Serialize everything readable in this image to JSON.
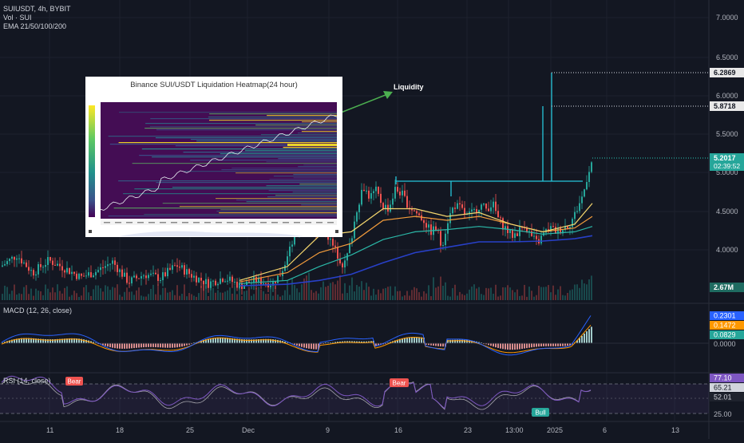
{
  "header": {
    "symbol_line": "SUIUSDT, 4h, BYBIT",
    "vol_line": "Vol · SUI",
    "ema_line": "EMA 21/50/100/200"
  },
  "price_axis": {
    "ticks": [
      "7.0000",
      "6.5000",
      "6.0000",
      "5.5000",
      "5.0000",
      "4.5000",
      "4.0000"
    ],
    "badges": {
      "target_high": "6.2869",
      "target_low": "5.8718",
      "last_price": "5.2017",
      "countdown": "02:39:52",
      "volume": "2.67M"
    }
  },
  "annotation": {
    "liquidity_label": "Liquidity"
  },
  "inset": {
    "title": "Binance SUI/USDT Liquidation Heatmap(24 hour)"
  },
  "macd": {
    "label": "MACD (12, 26, close)",
    "values": [
      "0.2301",
      "0.1472",
      "0.0829"
    ],
    "zero_tick": "0.0000"
  },
  "rsi": {
    "label": "RSI (14, close)",
    "values": [
      "77.10",
      "65.21",
      "52.01"
    ],
    "tick_25": "25.00",
    "signals": [
      "Bear",
      "Bear",
      "Bull"
    ]
  },
  "time_axis": {
    "labels": [
      "11",
      "18",
      "25",
      "Dec",
      "9",
      "16",
      "23",
      "13:00",
      "2025",
      "6",
      "13"
    ]
  },
  "colors": {
    "background": "#131722",
    "up": "#26a69a",
    "down": "#ef5350",
    "ema21": "#f5d76e",
    "ema50": "#f39c3c",
    "ema100": "#2bb8a8",
    "ema200": "#2840c8",
    "macd_line": "#2962ff",
    "signal_line": "#ff9800",
    "rsi_line": "#7e57c2",
    "annotation": "#26c6da"
  },
  "chart_data": {
    "type": "candlestick",
    "timeframe": "4h",
    "price_range": [
      3.5,
      7.1
    ],
    "close_path": [
      [
        0,
        3.8
      ],
      [
        20,
        3.95
      ],
      [
        40,
        3.72
      ],
      [
        60,
        3.88
      ],
      [
        80,
        3.78
      ],
      [
        100,
        3.66
      ],
      [
        120,
        3.74
      ],
      [
        140,
        3.86
      ],
      [
        160,
        3.6
      ],
      [
        180,
        3.7
      ],
      [
        200,
        3.65
      ],
      [
        220,
        3.82
      ],
      [
        240,
        3.68
      ],
      [
        260,
        3.58
      ],
      [
        280,
        3.66
      ],
      [
        300,
        3.55
      ],
      [
        320,
        3.62
      ],
      [
        340,
        3.58
      ],
      [
        350,
        3.7
      ],
      [
        360,
        3.95
      ],
      [
        368,
        4.2
      ],
      [
        376,
        4.45
      ],
      [
        386,
        4.4
      ],
      [
        396,
        4.22
      ],
      [
        406,
        4.3
      ],
      [
        414,
        4.1
      ],
      [
        422,
        3.95
      ],
      [
        430,
        3.8
      ],
      [
        438,
        4.1
      ],
      [
        446,
        4.55
      ],
      [
        454,
        4.85
      ],
      [
        462,
        4.7
      ],
      [
        470,
        4.78
      ],
      [
        478,
        4.6
      ],
      [
        486,
        4.55
      ],
      [
        494,
        4.8
      ],
      [
        502,
        4.75
      ],
      [
        510,
        4.6
      ],
      [
        520,
        4.5
      ],
      [
        530,
        4.4
      ],
      [
        538,
        4.25
      ],
      [
        546,
        4.3
      ],
      [
        552,
        4.05
      ],
      [
        560,
        4.4
      ],
      [
        568,
        4.6
      ],
      [
        576,
        4.55
      ],
      [
        584,
        4.45
      ],
      [
        592,
        4.5
      ],
      [
        600,
        4.6
      ],
      [
        608,
        4.55
      ],
      [
        616,
        4.62
      ],
      [
        624,
        4.4
      ],
      [
        632,
        4.3
      ],
      [
        640,
        4.2
      ],
      [
        648,
        4.25
      ],
      [
        656,
        4.35
      ],
      [
        664,
        4.2
      ],
      [
        672,
        4.1
      ],
      [
        680,
        4.22
      ],
      [
        688,
        4.3
      ],
      [
        696,
        4.25
      ],
      [
        704,
        4.3
      ],
      [
        712,
        4.35
      ],
      [
        718,
        4.45
      ],
      [
        724,
        4.6
      ],
      [
        730,
        4.75
      ],
      [
        734,
        4.95
      ],
      [
        738,
        5.1
      ],
      [
        742,
        5.2
      ]
    ],
    "ema21_path": [
      [
        300,
        3.62
      ],
      [
        360,
        3.8
      ],
      [
        400,
        4.2
      ],
      [
        440,
        4.25
      ],
      [
        480,
        4.55
      ],
      [
        520,
        4.55
      ],
      [
        560,
        4.45
      ],
      [
        600,
        4.5
      ],
      [
        640,
        4.35
      ],
      [
        680,
        4.25
      ],
      [
        720,
        4.35
      ],
      [
        742,
        4.62
      ]
    ],
    "ema50_path": [
      [
        300,
        3.6
      ],
      [
        360,
        3.72
      ],
      [
        400,
        3.98
      ],
      [
        440,
        4.1
      ],
      [
        480,
        4.4
      ],
      [
        520,
        4.45
      ],
      [
        560,
        4.4
      ],
      [
        600,
        4.45
      ],
      [
        640,
        4.35
      ],
      [
        680,
        4.25
      ],
      [
        720,
        4.3
      ],
      [
        742,
        4.45
      ]
    ],
    "ema100_path": [
      [
        300,
        3.58
      ],
      [
        360,
        3.62
      ],
      [
        400,
        3.8
      ],
      [
        440,
        3.95
      ],
      [
        480,
        4.15
      ],
      [
        520,
        4.25
      ],
      [
        560,
        4.28
      ],
      [
        600,
        4.32
      ],
      [
        640,
        4.28
      ],
      [
        680,
        4.22
      ],
      [
        720,
        4.25
      ],
      [
        742,
        4.32
      ]
    ],
    "ema200_path": [
      [
        300,
        3.55
      ],
      [
        360,
        3.57
      ],
      [
        400,
        3.62
      ],
      [
        440,
        3.7
      ],
      [
        480,
        3.85
      ],
      [
        520,
        3.98
      ],
      [
        560,
        4.05
      ],
      [
        600,
        4.12
      ],
      [
        640,
        4.12
      ],
      [
        680,
        4.13
      ],
      [
        720,
        4.16
      ],
      [
        742,
        4.2
      ]
    ],
    "levels": {
      "resistance": 4.88,
      "target_low": 5.8718,
      "target_high": 6.2869,
      "last_price": 5.2017
    },
    "macd_range": [
      -0.3,
      0.3
    ],
    "macd_latest": {
      "macd": 0.2301,
      "signal": 0.1472,
      "histogram": 0.0829
    },
    "rsi_range": [
      20,
      85
    ],
    "rsi_latest": {
      "rsi": 77.1,
      "ma": 65.21,
      "level": 52.01
    }
  }
}
